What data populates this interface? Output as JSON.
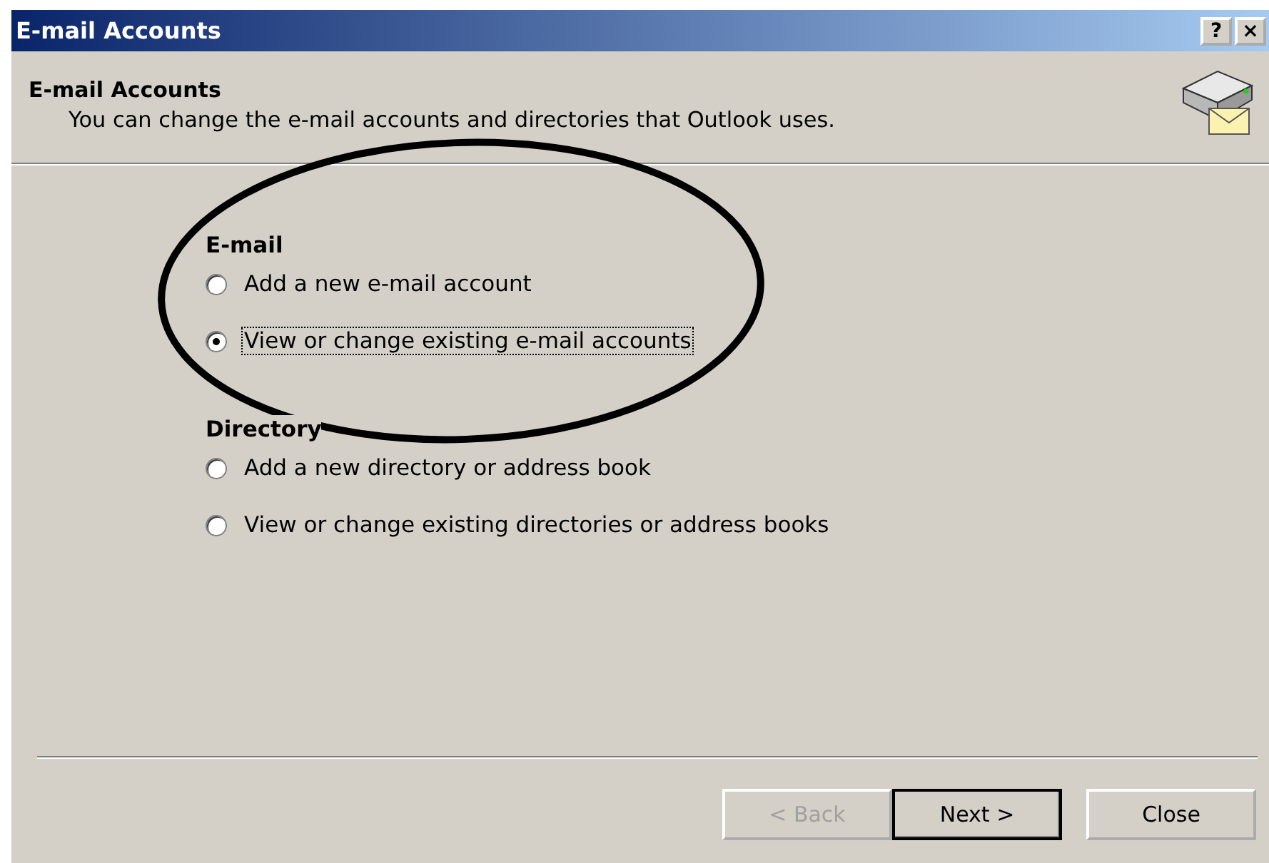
{
  "window": {
    "title": "E-mail Accounts",
    "title_buttons": [
      "?",
      "×"
    ]
  },
  "header": {
    "title": "E-mail Accounts",
    "subtitle": "You can change the e-mail accounts and directories that Outlook uses."
  },
  "groups": [
    {
      "label": "E-mail",
      "options": [
        {
          "label": "Add a new e-mail account",
          "selected": false,
          "focused": false
        },
        {
          "label": "View or change existing e-mail accounts",
          "selected": true,
          "focused": true
        }
      ]
    },
    {
      "label": "Directory",
      "options": [
        {
          "label": "Add a new directory or address book",
          "selected": false,
          "focused": false
        },
        {
          "label": "View or change existing directories or address books",
          "selected": false,
          "focused": false
        }
      ]
    }
  ],
  "buttons": [
    {
      "label": "< Back",
      "disabled": true,
      "default": false
    },
    {
      "label": "Next >",
      "disabled": false,
      "default": true
    },
    {
      "label": "Close",
      "disabled": false,
      "default": false
    }
  ]
}
